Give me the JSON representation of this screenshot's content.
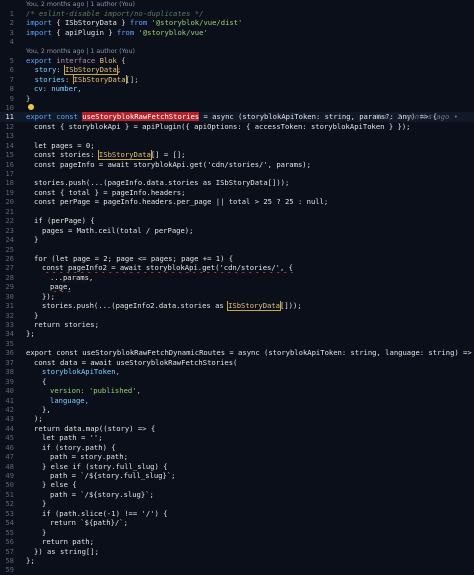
{
  "lens1": "You, 2 months ago | 1 author (You)",
  "lens2": "You, 2 months ago | 1 author (You)",
  "lens3": "You, 2 months ago | 1 author (You)",
  "blame_line11": "You, 2 months ago •",
  "lines": {
    "l1": "/* eslint-disable import/no-duplicates */",
    "l2a": "import",
    "l2b": "{ ISbStoryData }",
    "l2c": "from",
    "l2d": "'@storyblok/vue/dist'",
    "l3a": "import",
    "l3b": "{ apiPlugin }",
    "l3c": "from",
    "l3d": "'@storyblok/vue'",
    "l5a": "export",
    "l5b": "interface",
    "l5c": "Blok",
    "l6a": "story",
    "l6b": "ISbStoryData",
    "l7a": "stories",
    "l7b": "ISbStoryData",
    "l8": "cv: number,",
    "l11a": "export const",
    "l11b": "useStoryblokRawFetchStories",
    "l11c": "= async (storyblokApiToken: string, params?: any) => {",
    "l12": "const { storyblokApi } = apiPlugin({ apiOptions: { accessToken: storyblokApiToken } });",
    "l14": "let pages = 0;",
    "l15a": "const stories:",
    "l15b": "ISbStoryData",
    "l15c": "[] = [];",
    "l16": "const pageInfo = await storyblokApi.get('cdn/stories/', params);",
    "l18": "stories.push(...(pageInfo.data.stories as ISbStoryData[]));",
    "l19": "const { total } = pageInfo.headers;",
    "l20": "const perPage = pageInfo.headers.per_page || total > 25 ? 25 : null;",
    "l22": "if (perPage) {",
    "l23": "pages = Math.ceil(total / perPage);",
    "l24": "}",
    "l26": "for (let page = 2; page <= pages; page += 1) {",
    "l27": "const pageInfo2 = await storyblokApi.get('cdn/stories/', {",
    "l28": "...params,",
    "l29": "page,",
    "l30": "});",
    "l31a": "stories.push(...(pageInfo2.data.stories as",
    "l31b": "ISbStoryData",
    "l31c": "[]));",
    "l32": "}",
    "l33": "return stories;",
    "l34": "};",
    "l36": "export const useStoryblokRawFetchDynamicRoutes = async (storyblokApiToken: string, language: string) => {",
    "l37": "const data = await useStoryblokRawFetchStories(",
    "l38": "storyblokApiToken,",
    "l39": "{",
    "l40": "version: 'published',",
    "l41": "language,",
    "l42": "},",
    "l43": ");",
    "l44": "return data.map((story) => {",
    "l45": "let path = '';",
    "l46": "if (story.path) {",
    "l47": "path = story.path;",
    "l48": "} else if (story.full_slug) {",
    "l49": "path = `/${story.full_slug}`;",
    "l50": "} else {",
    "l51": "path = `/${story.slug}`;",
    "l52": "}",
    "l53": "if (path.slice(-1) !== '/') {",
    "l54": "return `${path}/`;",
    "l55": "}",
    "l56": "return path;",
    "l57": "}) as string[];",
    "l58": "};",
    "l59": ""
  }
}
